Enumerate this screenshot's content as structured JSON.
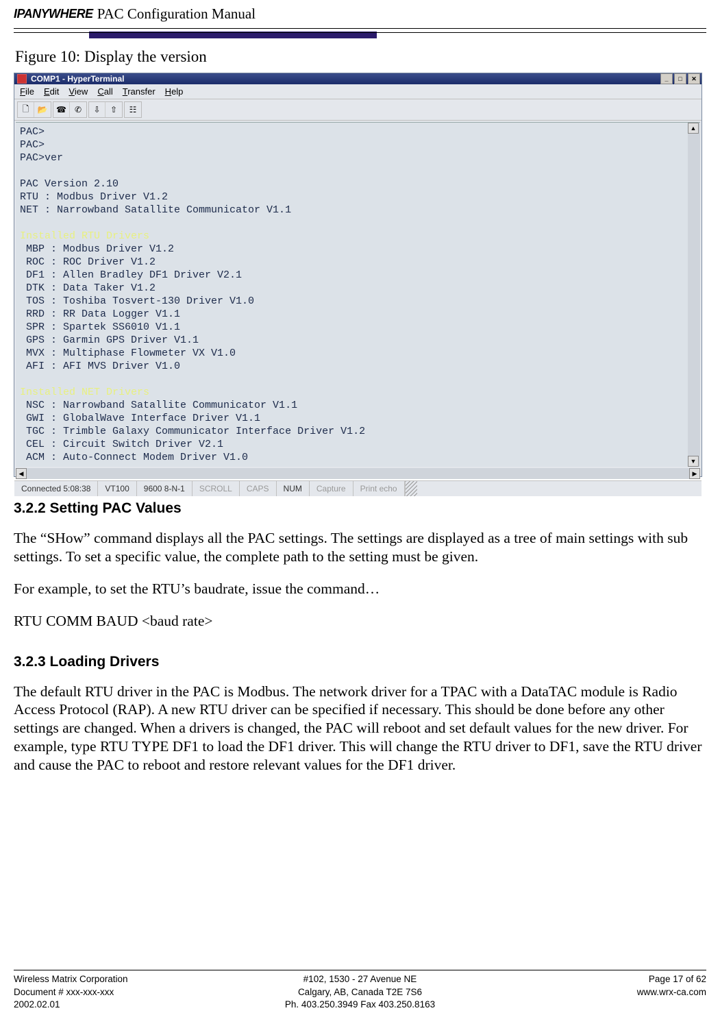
{
  "header": {
    "logo": "IPANYWHERE",
    "title": "PAC Configuration Manual"
  },
  "figure_caption": "Figure 10:     Display the version",
  "terminal": {
    "window_title": "COMP1 - HyperTerminal",
    "menu": [
      "File",
      "Edit",
      "View",
      "Call",
      "Transfer",
      "Help"
    ],
    "toolbar_icons": [
      "new-file-icon",
      "open-icon",
      "connect-icon",
      "disconnect-icon",
      "send-icon",
      "receive-icon",
      "properties-icon"
    ],
    "lines": [
      "PAC>",
      "PAC>",
      "PAC>ver",
      "",
      "PAC Version 2.10",
      "RTU : Modbus Driver V1.2",
      "NET : Narrowband Satallite Communicator V1.1",
      "",
      "Installed RTU Drivers",
      " MBP : Modbus Driver V1.2",
      " ROC : ROC Driver V1.2",
      " DF1 : Allen Bradley DF1 Driver V2.1",
      " DTK : Data Taker V1.2",
      " TOS : Toshiba Tosvert-130 Driver V1.0",
      " RRD : RR Data Logger V1.1",
      " SPR : Spartek SS6010 V1.1",
      " GPS : Garmin GPS Driver V1.1",
      " MVX : Multiphase Flowmeter VX V1.0",
      " AFI : AFI MVS Driver V1.0",
      "",
      "Installed NET Drivers",
      " NSC : Narrowband Satallite Communicator V1.1",
      " GWI : GlobalWave Interface Driver V1.1",
      " TGC : Trimble Galaxy Communicator Interface Driver V1.2",
      " CEL : Circuit Switch Driver V2.1",
      " ACM : Auto-Connect Modem Driver V1.0"
    ],
    "status": {
      "connected": "Connected 5:08:38",
      "emulation": "VT100",
      "settings": "9600 8-N-1",
      "scroll": "SCROLL",
      "caps": "CAPS",
      "num": "NUM",
      "capture": "Capture",
      "print_echo": "Print echo"
    }
  },
  "sections": {
    "s322": {
      "heading": "3.2.2  Setting PAC Values",
      "p1": "The “SHow” command displays all the PAC settings.  The settings are displayed as a tree of main settings with sub settings.  To set a specific value, the complete path to the setting must be given.",
      "p2": "For example, to set the RTU’s baudrate, issue the command…",
      "p3": "RTU COMM BAUD <baud rate>"
    },
    "s323": {
      "heading": "3.2.3  Loading Drivers",
      "p1": "The default RTU driver in the PAC is Modbus.  The network driver for a TPAC with a DataTAC module is Radio Access Protocol (RAP).  A new RTU driver can be specified if necessary.  This should be done before any other settings are changed.  When a drivers is changed, the PAC will reboot and set default values for the new driver.  For example, type RTU TYPE DF1 to load the DF1 driver.  This will change the RTU driver to DF1, save the RTU driver and cause the PAC to reboot and restore relevant values for the DF1 driver."
    }
  },
  "footer": {
    "left1": "Wireless Matrix Corporation",
    "left2": "Document # xxx-xxx-xxx",
    "left3": "2002.02.01",
    "center1": "#102, 1530 - 27 Avenue NE",
    "center2": "Calgary, AB, Canada  T2E 7S6",
    "center3": "Ph. 403.250.3949  Fax 403.250.8163",
    "right1": "Page 17 of 62",
    "right2": "",
    "right3": "www.wrx-ca.com"
  }
}
